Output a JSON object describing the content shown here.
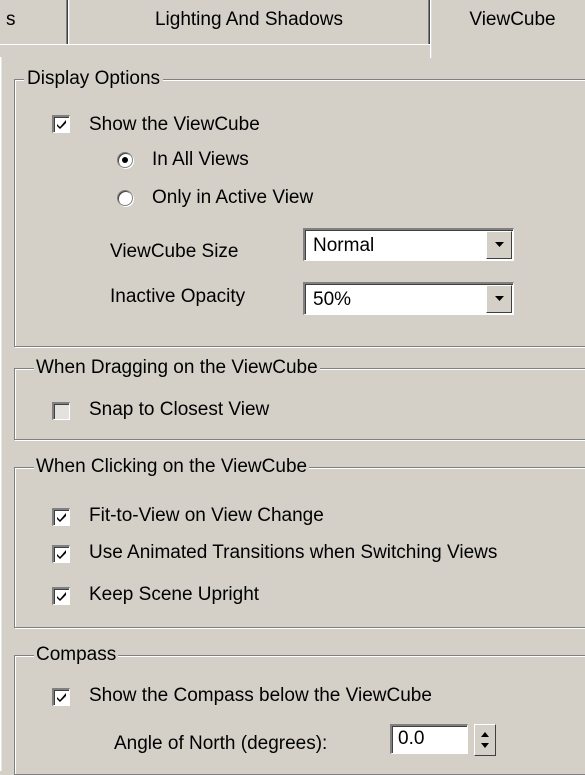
{
  "tabs": [
    {
      "label": "s"
    },
    {
      "label": "Lighting And Shadows"
    },
    {
      "label": "ViewCube"
    }
  ],
  "display_options": {
    "legend": "Display Options",
    "show_viewcube": {
      "label": "Show the ViewCube",
      "checked": true
    },
    "radio_all_views": {
      "label": "In All Views",
      "selected": true
    },
    "radio_active_view": {
      "label": "Only in Active View",
      "selected": false
    },
    "size_label": "ViewCube Size",
    "size_value": "Normal",
    "opacity_label": "Inactive Opacity",
    "opacity_value": "50%"
  },
  "dragging": {
    "legend": "When Dragging on the ViewCube",
    "snap": {
      "label": "Snap to Closest View",
      "checked": false
    }
  },
  "clicking": {
    "legend": "When Clicking on the ViewCube",
    "fit_to_view": {
      "label": "Fit-to-View on View Change",
      "checked": true
    },
    "animated": {
      "label": "Use Animated Transitions when Switching Views",
      "checked": true
    },
    "upright": {
      "label": "Keep Scene Upright",
      "checked": true
    }
  },
  "compass": {
    "legend": "Compass",
    "show_compass": {
      "label": "Show the Compass below the ViewCube",
      "checked": true
    },
    "angle_label": "Angle of North (degrees):",
    "angle_value": "0.0"
  },
  "colors": {
    "face": "#d4d0c8",
    "shadow": "#808080",
    "highlight": "#ffffff"
  }
}
